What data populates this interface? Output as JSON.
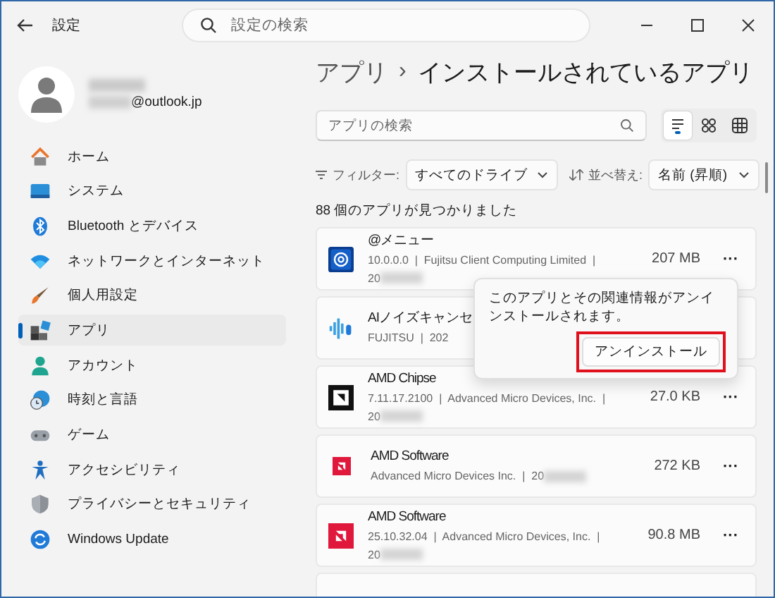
{
  "window": {
    "title": "設定"
  },
  "search": {
    "placeholder": "設定の検索"
  },
  "profile": {
    "email": "@outlook.jp"
  },
  "sidebar": {
    "items": [
      {
        "label": "ホーム",
        "selected": false
      },
      {
        "label": "システム",
        "selected": false
      },
      {
        "label": "Bluetooth とデバイス",
        "selected": false
      },
      {
        "label": "ネットワークとインターネット",
        "selected": false
      },
      {
        "label": "個人用設定",
        "selected": false
      },
      {
        "label": "アプリ",
        "selected": true
      },
      {
        "label": "アカウント",
        "selected": false
      },
      {
        "label": "時刻と言語",
        "selected": false
      },
      {
        "label": "ゲーム",
        "selected": false
      },
      {
        "label": "アクセシビリティ",
        "selected": false
      },
      {
        "label": "プライバシーとセキュリティ",
        "selected": false
      },
      {
        "label": "Windows Update",
        "selected": false
      }
    ]
  },
  "breadcrumb": {
    "parent": "アプリ",
    "separator": "›",
    "current": "インストールされているアプリ"
  },
  "app_search": {
    "placeholder": "アプリの検索"
  },
  "views": [
    {
      "selected": true
    },
    {
      "selected": false
    },
    {
      "selected": false
    }
  ],
  "filter": {
    "label": "フィルター:",
    "value": "すべてのドライブ"
  },
  "sort": {
    "label": "並べ替え:",
    "value": "名前 (昇順)"
  },
  "count": "88 個のアプリが見つかりました",
  "apps": [
    {
      "name": "@メニュー",
      "meta": [
        "10.0.0.0  |  Fujitsu Client Computing Limited  |",
        "20"
      ],
      "size": "207 MB",
      "more": "···"
    },
    {
      "name": "AIノイズキャンセ",
      "meta": [
        "FUJITSU  |  202"
      ]
    },
    {
      "name": "AMD Chipse",
      "meta": [
        "7.11.17.2100  |  Advanced Micro Devices, Inc.  |",
        "20"
      ],
      "size": "27.0 KB",
      "more": "···"
    },
    {
      "name": "AMD Software",
      "meta": [
        "Advanced Micro Devices Inc.  |  20"
      ],
      "size": "272 KB",
      "more": "···"
    },
    {
      "name": "AMD Software",
      "meta": [
        "25.10.32.04  |  Advanced Micro Devices, Inc.  |",
        "20"
      ],
      "size": "90.8 MB",
      "more": "···"
    }
  ],
  "flyout": {
    "message": "このアプリとその関連情報がアンインストールされます。",
    "button": "アンインストール",
    "highlighted": true
  }
}
